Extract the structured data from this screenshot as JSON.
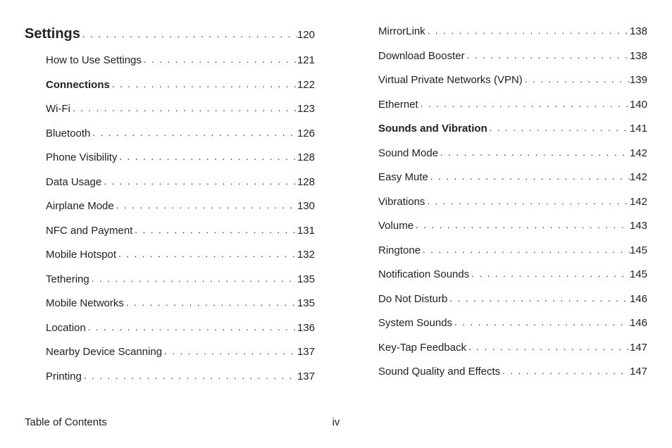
{
  "footer": {
    "label": "Table of Contents",
    "pagenum": "iv"
  },
  "columns": [
    [
      {
        "title": "Settings",
        "page": "120",
        "level": 0,
        "heading": true
      },
      {
        "title": "How to Use Settings",
        "page": "121",
        "level": 1
      },
      {
        "title": "Connections",
        "page": "122",
        "level": 1,
        "bold": true
      },
      {
        "title": "Wi-Fi",
        "page": "123",
        "level": 2
      },
      {
        "title": "Bluetooth",
        "page": "126",
        "level": 2
      },
      {
        "title": "Phone Visibility",
        "page": "128",
        "level": 2
      },
      {
        "title": "Data Usage",
        "page": "128",
        "level": 2
      },
      {
        "title": "Airplane Mode",
        "page": "130",
        "level": 2
      },
      {
        "title": "NFC and Payment",
        "page": "131",
        "level": 2
      },
      {
        "title": "Mobile Hotspot",
        "page": "132",
        "level": 2
      },
      {
        "title": "Tethering",
        "page": "135",
        "level": 2
      },
      {
        "title": "Mobile Networks",
        "page": "135",
        "level": 2
      },
      {
        "title": "Location",
        "page": "136",
        "level": 2
      },
      {
        "title": "Nearby Device Scanning",
        "page": "137",
        "level": 2
      },
      {
        "title": "Printing",
        "page": "137",
        "level": 2
      }
    ],
    [
      {
        "title": "MirrorLink",
        "page": "138",
        "level": 2
      },
      {
        "title": "Download Booster",
        "page": "138",
        "level": 2
      },
      {
        "title": "Virtual Private Networks (VPN)",
        "page": "139",
        "level": 2
      },
      {
        "title": "Ethernet",
        "page": "140",
        "level": 2
      },
      {
        "title": "Sounds and Vibration",
        "page": "141",
        "level": 1,
        "bold": true
      },
      {
        "title": "Sound Mode",
        "page": "142",
        "level": 2
      },
      {
        "title": "Easy Mute",
        "page": "142",
        "level": 2
      },
      {
        "title": "Vibrations",
        "page": "142",
        "level": 2
      },
      {
        "title": "Volume",
        "page": "143",
        "level": 2
      },
      {
        "title": "Ringtone",
        "page": "145",
        "level": 2
      },
      {
        "title": "Notification Sounds",
        "page": "145",
        "level": 2
      },
      {
        "title": "Do Not Disturb",
        "page": "146",
        "level": 2
      },
      {
        "title": "System Sounds",
        "page": "146",
        "level": 2
      },
      {
        "title": "Key-Tap Feedback",
        "page": "147",
        "level": 2
      },
      {
        "title": "Sound Quality and Effects",
        "page": "147",
        "level": 2
      }
    ]
  ]
}
